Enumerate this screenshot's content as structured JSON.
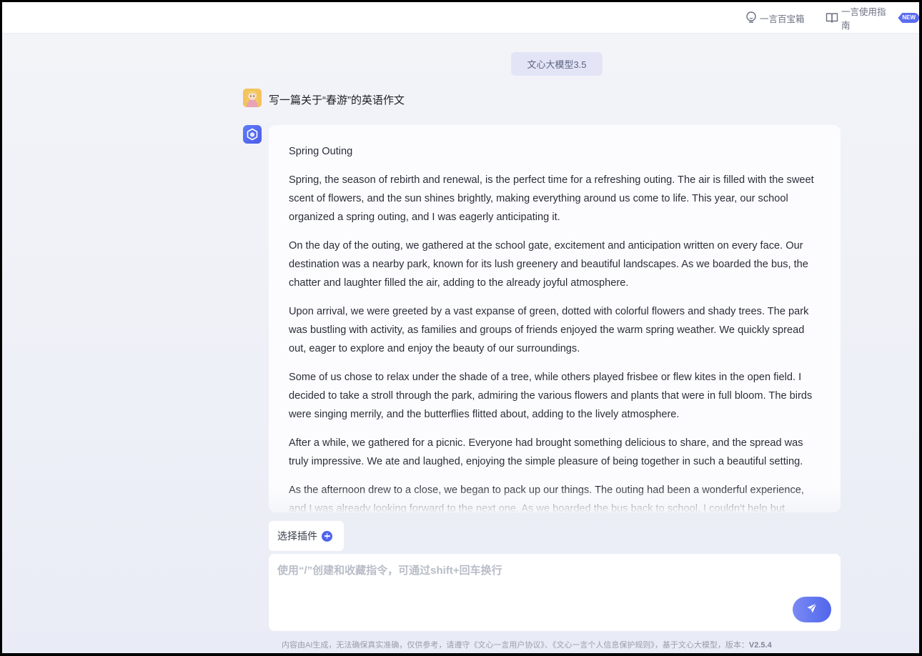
{
  "topbar": {
    "treasure_label": "一言百宝箱",
    "guide_label": "一言使用指南",
    "new_badge": "NEW"
  },
  "model_chip": "文心大模型3.5",
  "conversation": {
    "user_message": "写一篇关于“春游”的英语作文",
    "answer_title": "Spring Outing",
    "answer_paragraphs": [
      "Spring, the season of rebirth and renewal, is the perfect time for a refreshing outing. The air is filled with the sweet scent of flowers, and the sun shines brightly, making everything around us come to life. This year, our school organized a spring outing, and I was eagerly anticipating it.",
      "On the day of the outing, we gathered at the school gate, excitement and anticipation written on every face. Our destination was a nearby park, known for its lush greenery and beautiful landscapes. As we boarded the bus, the chatter and laughter filled the air, adding to the already joyful atmosphere.",
      "Upon arrival, we were greeted by a vast expanse of green, dotted with colorful flowers and shady trees. The park was bustling with activity, as families and groups of friends enjoyed the warm spring weather. We quickly spread out, eager to explore and enjoy the beauty of our surroundings.",
      "Some of us chose to relax under the shade of a tree, while others played frisbee or flew kites in the open field. I decided to take a stroll through the park, admiring the various flowers and plants that were in full bloom. The birds were singing merrily, and the butterflies flitted about, adding to the lively atmosphere.",
      "After a while, we gathered for a picnic. Everyone had brought something delicious to share, and the spread was truly impressive. We ate and laughed, enjoying the simple pleasure of being together in such a beautiful setting.",
      "As the afternoon drew to a close, we began to pack up our things. The outing had been a wonderful experience, and I was already looking forward to the next one. As we boarded the bus back to school, I couldn't help but"
    ]
  },
  "composer": {
    "plugin_label": "选择插件",
    "input_placeholder": "使用“/”创建和收藏指令，可通过shift+回车换行",
    "input_value": ""
  },
  "footer": {
    "note": "内容由AI生成，无法确保真实准确，仅供参考，请遵守《文心一言用户协议》、《文心一言个人信息保护规则》，基于文心大模型，版本：",
    "version": "V2.5.4"
  },
  "colors": {
    "accent": "#4e63ee",
    "background": "#eef0f7"
  },
  "icons": {
    "treasure": "lightbulb-icon",
    "guide": "book-icon",
    "plugin": "plus-circle-icon",
    "send": "paper-plane-icon",
    "bot": "cube-logo-icon"
  }
}
